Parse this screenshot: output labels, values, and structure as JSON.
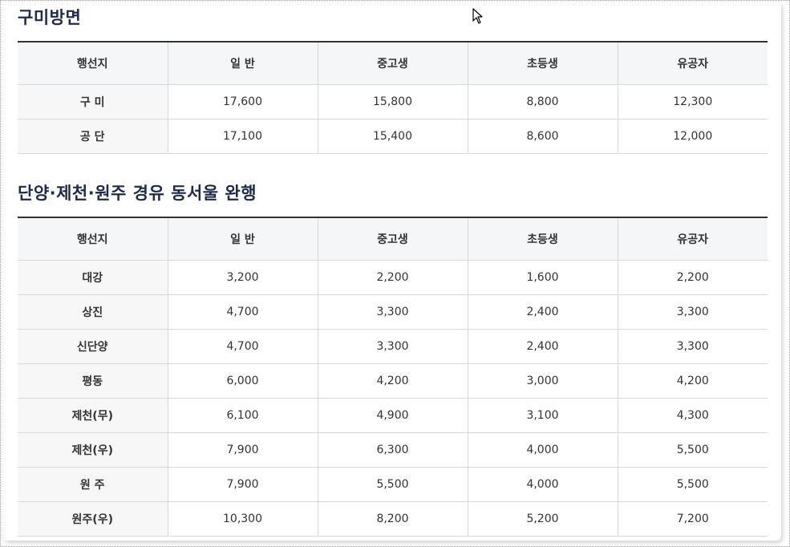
{
  "sections": [
    {
      "title": "구미방면",
      "headers": [
        "행선지",
        "일 반",
        "중고생",
        "초등생",
        "유공자"
      ],
      "rows": [
        [
          "구 미",
          "17,600",
          "15,800",
          "8,800",
          "12,300"
        ],
        [
          "공 단",
          "17,100",
          "15,400",
          "8,600",
          "12,000"
        ]
      ]
    },
    {
      "title": "단양·제천·원주 경유 동서울 완행",
      "headers": [
        "행선지",
        "일 반",
        "중고생",
        "초등생",
        "유공자"
      ],
      "rows": [
        [
          "대강",
          "3,200",
          "2,200",
          "1,600",
          "2,200"
        ],
        [
          "상진",
          "4,700",
          "3,300",
          "2,400",
          "3,300"
        ],
        [
          "신단양",
          "4,700",
          "3,300",
          "2,400",
          "3,300"
        ],
        [
          "평동",
          "6,000",
          "4,200",
          "3,000",
          "4,200"
        ],
        [
          "제천(무)",
          "6,100",
          "4,900",
          "3,100",
          "4,300"
        ],
        [
          "제천(우)",
          "7,900",
          "6,300",
          "4,000",
          "5,500"
        ],
        [
          "원 주",
          "7,900",
          "5,500",
          "4,000",
          "5,500"
        ],
        [
          "원주(우)",
          "10,300",
          "8,200",
          "5,200",
          "7,200"
        ]
      ]
    }
  ],
  "icons": {
    "cursor": "mouse-pointer-icon"
  }
}
